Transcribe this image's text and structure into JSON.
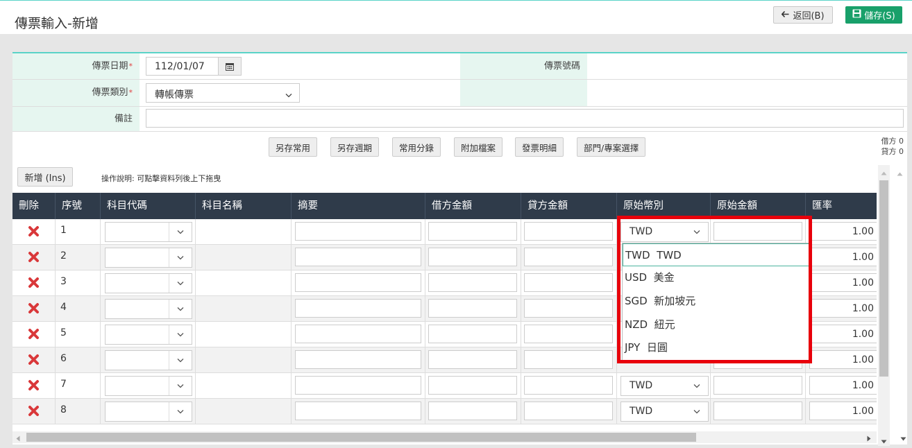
{
  "header": {
    "title": "傳票輸入-新增",
    "back_label": "返回(B)",
    "save_label": "儲存(S)"
  },
  "form": {
    "date_label": "傳票日期",
    "date_value": "112/01/07",
    "number_label": "傳票號碼",
    "number_value": "",
    "type_label": "傳票類別",
    "type_value": "轉帳傳票",
    "remark_label": "備註",
    "remark_value": "",
    "required_mark": "*"
  },
  "toolbar": {
    "buttons": [
      "另存常用",
      "另存週期",
      "常用分錄",
      "附加檔案",
      "發票明細",
      "部門/專案選擇"
    ]
  },
  "totals": {
    "debit_label": "借方",
    "debit_value": "0",
    "credit_label": "貸方",
    "credit_value": "0"
  },
  "grid": {
    "add_label": "新增 (Ins)",
    "hint": "操作說明: 可點擊資料列後上下拖曳",
    "columns": [
      "刪除",
      "序號",
      "科目代碼",
      "科目名稱",
      "摘要",
      "借方金額",
      "貸方金額",
      "原始幣別",
      "原始金額",
      "匯率"
    ],
    "rows": [
      {
        "seq": "1",
        "currency": "TWD",
        "rate": "1.00"
      },
      {
        "seq": "2",
        "currency": "",
        "rate": "1.00"
      },
      {
        "seq": "3",
        "currency": "",
        "rate": "1.00"
      },
      {
        "seq": "4",
        "currency": "",
        "rate": "1.00"
      },
      {
        "seq": "5",
        "currency": "",
        "rate": "1.00"
      },
      {
        "seq": "6",
        "currency": "",
        "rate": "1.00"
      },
      {
        "seq": "7",
        "currency": "TWD",
        "rate": "1.00"
      },
      {
        "seq": "8",
        "currency": "TWD",
        "rate": "1.00"
      }
    ]
  },
  "currency_dropdown": {
    "options": [
      {
        "code": "TWD",
        "name": "TWD"
      },
      {
        "code": "USD",
        "name": "美金"
      },
      {
        "code": "SGD",
        "name": "新加坡元"
      },
      {
        "code": "NZD",
        "name": "紐元"
      },
      {
        "code": "JPY",
        "name": "日圓"
      }
    ],
    "selected": "TWD"
  },
  "colors": {
    "accent": "#59d3c7",
    "label_bg": "#e6f6f0",
    "header_bg": "#2f3b4a",
    "save_bg": "#18a06a",
    "delete_red": "#d9383a",
    "highlight_red": "#e8000b"
  },
  "icons": {
    "back": "arrow-left-icon",
    "save": "floppy-disk-icon",
    "calendar": "calendar-icon",
    "delete": "x-icon",
    "select": "chevron-down-icon"
  }
}
